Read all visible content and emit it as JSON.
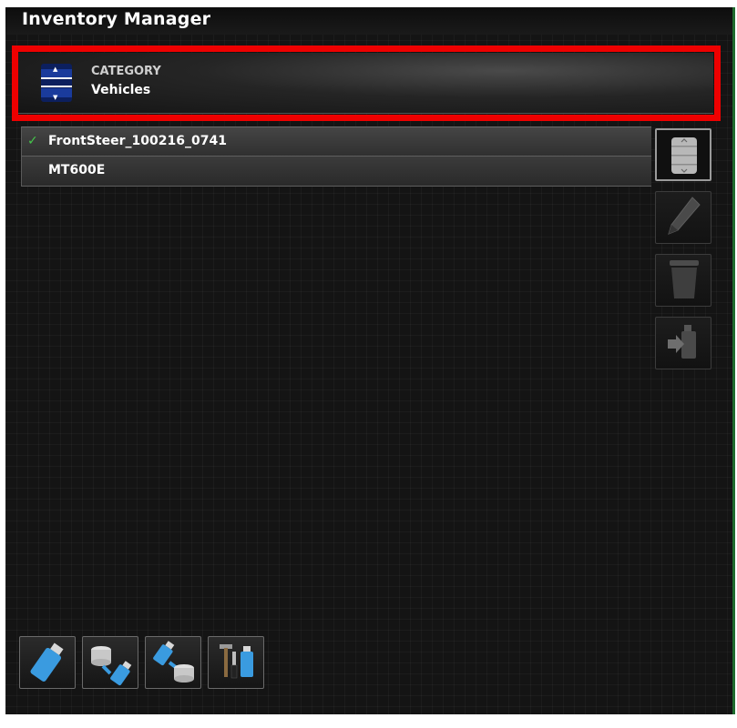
{
  "window": {
    "title": "Inventory Manager"
  },
  "category": {
    "label": "CATEGORY",
    "value": "Vehicles",
    "icon": "category-selector-icon"
  },
  "list": {
    "items": [
      {
        "label": "FrontSteer_100216_0741",
        "selected": true,
        "check": "✓"
      },
      {
        "label": "MT600E",
        "selected": false,
        "check": ""
      }
    ]
  },
  "toolbar": {
    "side_buttons": [
      {
        "icon": "list-selector-icon",
        "active": true
      },
      {
        "icon": "pencil-edit-icon",
        "active": false
      },
      {
        "icon": "trash-icon",
        "active": false
      },
      {
        "icon": "usb-export-icon",
        "active": false
      }
    ],
    "bottom_buttons": [
      {
        "icon": "usb-drive-icon"
      },
      {
        "icon": "database-to-usb-icon"
      },
      {
        "icon": "usb-to-database-icon"
      },
      {
        "icon": "tools-usb-icon"
      }
    ]
  },
  "colors": {
    "highlight": "#ee0000",
    "check": "#45c74b",
    "category_icon": "#1a3b9c",
    "usb_blue": "#3a9be0"
  }
}
